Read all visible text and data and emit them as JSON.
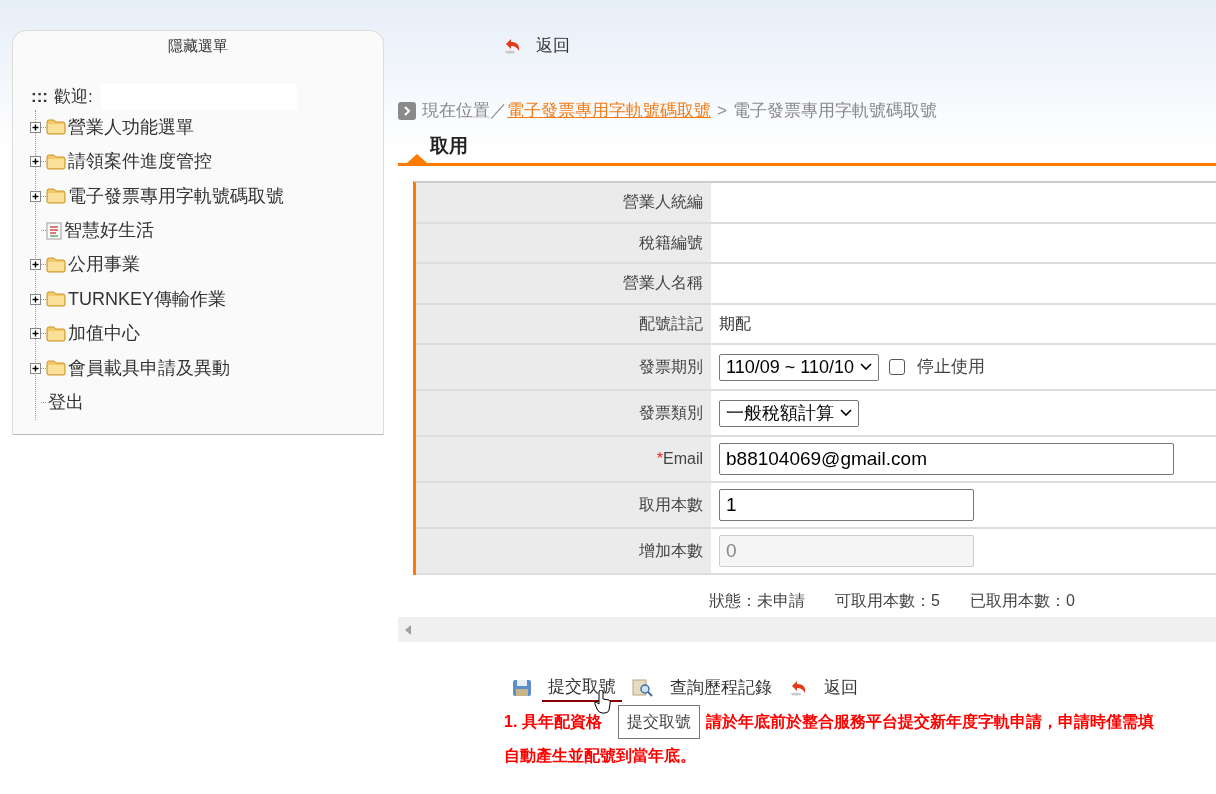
{
  "sidebar": {
    "title": "隱藏選單",
    "welcome_marker": ":::",
    "welcome_label": "歡迎:",
    "items": [
      {
        "label": "營業人功能選單",
        "kind": "folder",
        "expanded": false
      },
      {
        "label": "請領案件進度管控",
        "kind": "folder",
        "expanded": false
      },
      {
        "label": "電子發票專用字軌號碼取號",
        "kind": "folder",
        "expanded": false
      },
      {
        "label": "智慧好生活",
        "kind": "page"
      },
      {
        "label": "公用事業",
        "kind": "folder",
        "expanded": false
      },
      {
        "label": "TURNKEY傳輸作業",
        "kind": "folder",
        "expanded": false
      },
      {
        "label": "加值中心",
        "kind": "folder",
        "expanded": false
      },
      {
        "label": "會員載具申請及異動",
        "kind": "folder",
        "expanded": false
      },
      {
        "label": "登出",
        "kind": "link"
      }
    ]
  },
  "top_back": "返回",
  "breadcrumb": {
    "prefix": "現在位置",
    "separator": "／",
    "link": "電子發票專用字軌號碼取號",
    "arrow": ">",
    "current": "電子發票專用字軌號碼取號"
  },
  "section_title": "取用",
  "form": [
    {
      "label": "營業人統編",
      "kind": "text"
    },
    {
      "label": "稅籍編號",
      "kind": "text"
    },
    {
      "label": "營業人名稱",
      "kind": "text"
    },
    {
      "label": "配號註記",
      "kind": "text",
      "value": "期配"
    },
    {
      "label": "發票期別",
      "kind": "select",
      "value": "110/09 ~ 110/10",
      "checkbox": {
        "label": "停止使用",
        "checked": false
      }
    },
    {
      "label": "發票類別",
      "kind": "select",
      "value": "一般稅額計算"
    },
    {
      "label": "Email",
      "required_mark": "*",
      "kind": "wide_input",
      "value": "b88104069@gmail.com"
    },
    {
      "label": "取用本數",
      "kind": "input",
      "value": "1"
    },
    {
      "label": "增加本數",
      "kind": "input",
      "value": "0",
      "disabled": true
    }
  ],
  "status": [
    {
      "label": "狀態：",
      "value": "未申請"
    },
    {
      "label": "可取用本數：",
      "value": "5"
    },
    {
      "label": "已取用本數：",
      "value": "0"
    }
  ],
  "actions": [
    {
      "label": "提交取號",
      "hovered": true
    },
    {
      "label": "查詢歷程記錄",
      "hovered": false
    },
    {
      "label": "返回",
      "hovered": false
    }
  ],
  "tooltip": "提交取號",
  "notice": {
    "line1_start": "1. 具年配資格",
    "line1_rest": "請於年底前於整合服務平台提交新年度字軌申請，申請時僅需填",
    "line2": "自動產生並配號到當年底。"
  }
}
